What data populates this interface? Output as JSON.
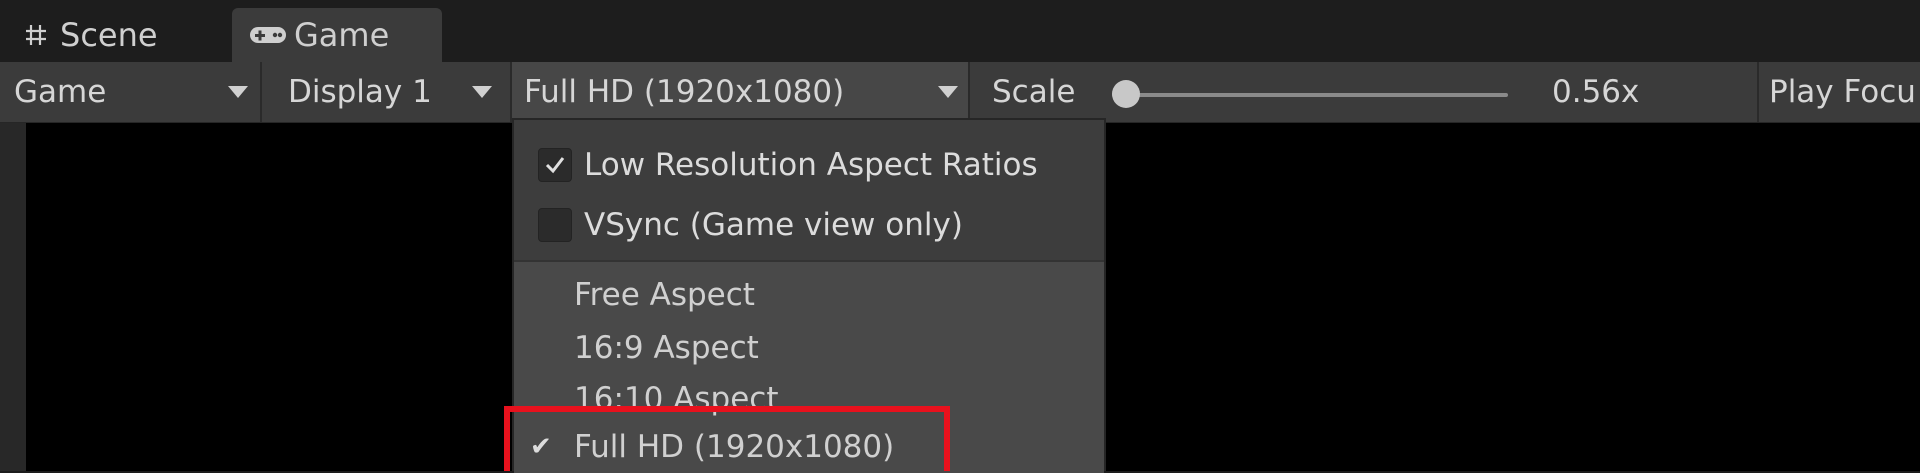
{
  "tabs": [
    {
      "label": "Scene",
      "icon": "grid-icon",
      "active": false
    },
    {
      "label": "Game",
      "icon": "gamepad-icon",
      "active": true
    }
  ],
  "toolbar": {
    "view_dropdown": "Game",
    "display_dropdown": "Display 1",
    "resolution_dropdown": "Full HD (1920x1080)",
    "scale_label": "Scale",
    "scale_value": "0.56x",
    "scale_fraction": 0.0,
    "play_focus_label": "Play Focu"
  },
  "resolution_menu": {
    "toggles": [
      {
        "label": "Low Resolution Aspect Ratios",
        "checked": true
      },
      {
        "label": "VSync (Game view only)",
        "checked": false
      }
    ],
    "options": [
      {
        "label": "Free Aspect",
        "selected": false
      },
      {
        "label": "16:9 Aspect",
        "selected": false
      },
      {
        "label": "16:10 Aspect",
        "selected": false
      },
      {
        "label": "Full HD (1920x1080)",
        "selected": true
      }
    ],
    "check_glyph": "✔"
  },
  "colors": {
    "toolbar_bg": "#3b3b3b",
    "menu_bg": "#494949",
    "highlight_box": "#e8111d"
  }
}
